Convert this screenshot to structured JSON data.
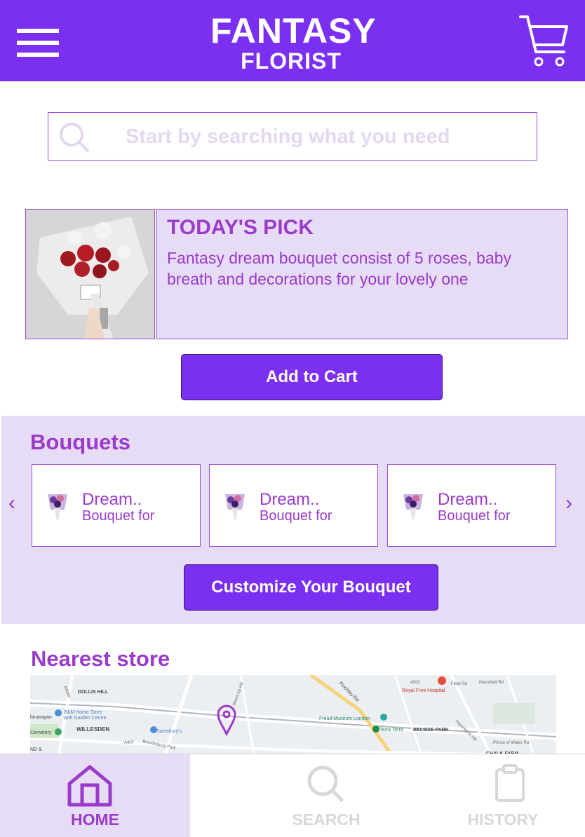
{
  "header": {
    "brand_line1": "FANTASY",
    "brand_line2": "FLORIST",
    "menu_icon": "hamburger-icon",
    "cart_icon": "cart-icon"
  },
  "search": {
    "placeholder": "Start by searching what you need",
    "icon": "search-icon"
  },
  "todays_pick": {
    "title": "TODAY'S PICK",
    "description": "Fantasy dream bouquet consist of 5 roses, baby breath and decorations for your lovely one",
    "add_to_cart_label": "Add to Cart"
  },
  "bouquets": {
    "title": "Bouquets",
    "prev_arrow": "‹",
    "next_arrow": "›",
    "items": [
      {
        "name": "Dream..",
        "subtitle": "Bouquet for"
      },
      {
        "name": "Dream..",
        "subtitle": "Bouquet for"
      },
      {
        "name": "Dream..",
        "subtitle": "Bouquet for"
      }
    ],
    "customize_label": "Customize Your Bouquet"
  },
  "nearest_store": {
    "title": "Nearest store",
    "map_labels": {
      "dollis_hill": "DOLLIS HILL",
      "bm_store_1": "B&M Home Store",
      "bm_store_2": "with Garden Centre",
      "shinarayan": "hinarayan",
      "cemetery": "Cemetery",
      "willesden": "WILLESDEN",
      "sainsburys": "Sainsbury's",
      "brondesbury": "Brondesbury Park",
      "royal_free": "Royal Free Hospital",
      "freud": "Freud Museum London",
      "terra": "Terra Terra",
      "belsize": "BELSIZE PARK",
      "chalk_farm": "CHALK FARM",
      "finchley": "Finchley Rd",
      "a4088": "A4088",
      "a407": "A407",
      "a502": "A502",
      "nd": "ND &",
      "prince": "Prince of Wales Rd",
      "shoot_up": "Shoot Up Hill",
      "fleet_rd": "Fleet Rd",
      "haverstock": "Haverstock Hill",
      "mansfield": "Mansfield Rd"
    }
  },
  "bottom_nav": {
    "items": [
      {
        "label": "HOME",
        "icon": "home-icon",
        "active": true
      },
      {
        "label": "SEARCH",
        "icon": "search-icon",
        "active": false
      },
      {
        "label": "HISTORY",
        "icon": "clipboard-icon",
        "active": false
      }
    ]
  },
  "colors": {
    "primary": "#7b2ff0",
    "accent_text": "#9a3bc9",
    "light_panel": "#e7dcf6",
    "inactive": "#d8d8d8"
  }
}
